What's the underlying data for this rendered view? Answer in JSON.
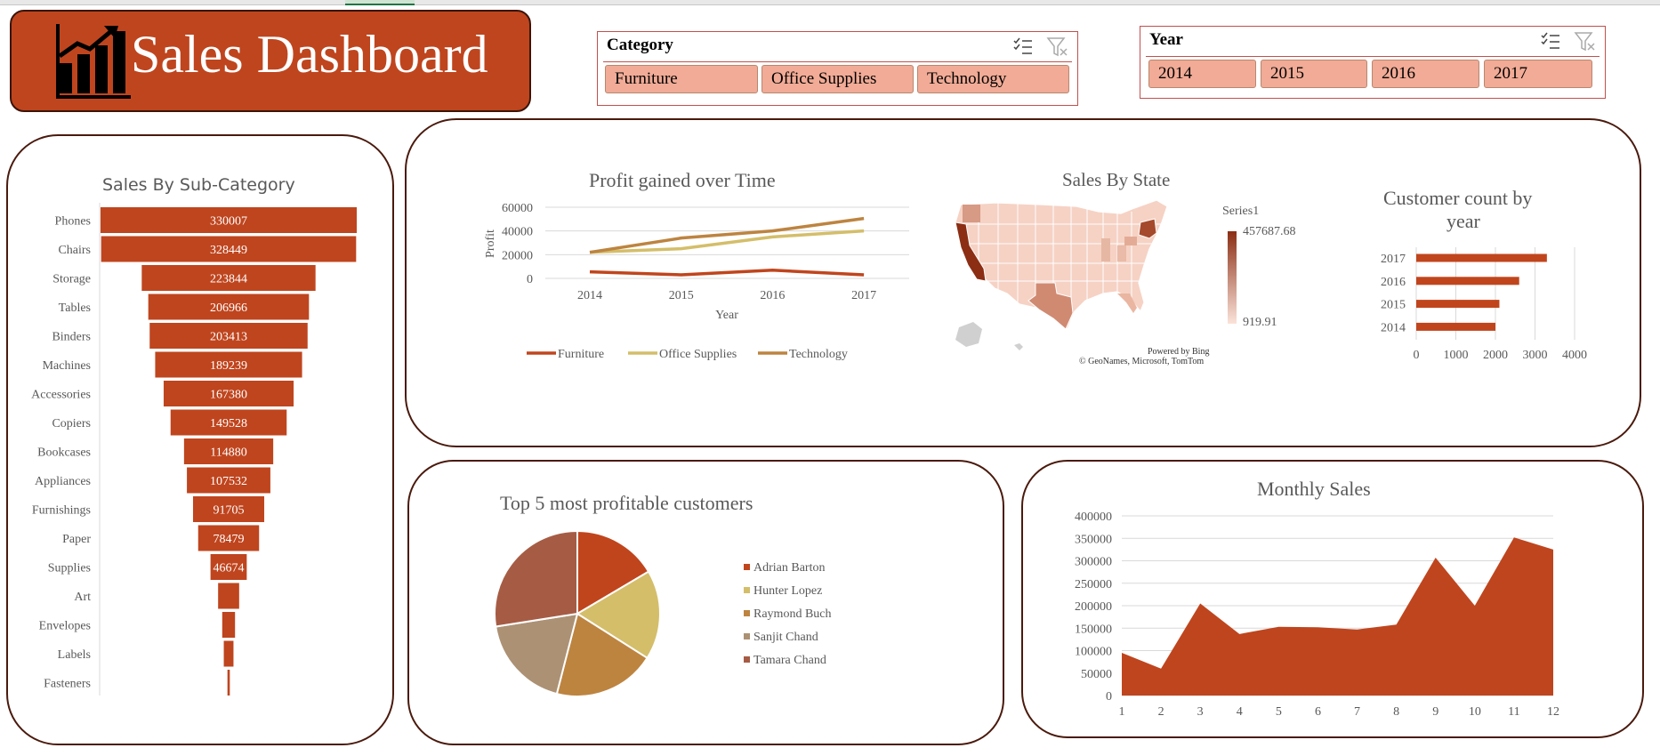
{
  "dashboard": {
    "title": "Sales Dashboard",
    "colors": {
      "accent": "#bf451e",
      "dark": "#4a1a0d",
      "slicer_item": "#f1ab96"
    }
  },
  "slicers": {
    "category": {
      "header": "Category",
      "items": [
        "Furniture",
        "Office Supplies",
        "Technology"
      ],
      "icons": [
        "multi-select-icon",
        "clear-filter-icon"
      ]
    },
    "year": {
      "header": "Year",
      "items": [
        "2014",
        "2015",
        "2016",
        "2017"
      ],
      "icons": [
        "multi-select-icon",
        "clear-filter-icon"
      ]
    }
  },
  "sales_by_subcategory": {
    "title": "Sales By Sub-Category",
    "chart_data": {
      "type": "bar",
      "orientation": "horizontal-funnel",
      "categories": [
        "Phones",
        "Chairs",
        "Storage",
        "Tables",
        "Binders",
        "Machines",
        "Accessories",
        "Copiers",
        "Bookcases",
        "Appliances",
        "Furnishings",
        "Paper",
        "Supplies",
        "Art",
        "Envelopes",
        "Labels",
        "Fasteners"
      ],
      "values": [
        330007,
        328449,
        223844,
        206966,
        203413,
        189239,
        167380,
        149528,
        114880,
        107532,
        91705,
        78479,
        46674,
        27119,
        16476,
        12486,
        3024
      ],
      "data_labels": [
        "330007",
        "328449",
        "223844",
        "206966",
        "203413",
        "189239",
        "167380",
        "149528",
        "114880",
        "107532",
        "91705",
        "78479",
        "46674",
        "",
        "",
        "",
        ""
      ],
      "color": "#bf451e"
    }
  },
  "profit_over_time": {
    "title": "Profit gained over Time",
    "chart_data": {
      "type": "line",
      "x": [
        "2014",
        "2015",
        "2016",
        "2017"
      ],
      "xlabel": "Year",
      "ylabel": "Profit",
      "yticks": [
        "60000",
        "40000",
        "20000",
        "0"
      ],
      "ylim": [
        0,
        60000
      ],
      "series": [
        {
          "name": "Furniture",
          "values": [
            5500,
            3000,
            6900,
            3000
          ],
          "color": "#c0451d"
        },
        {
          "name": "Office Supplies",
          "values": [
            22000,
            25000,
            35000,
            40000
          ],
          "color": "#d4be6a"
        },
        {
          "name": "Technology",
          "values": [
            22000,
            34000,
            40000,
            50500
          ],
          "color": "#bd8440"
        }
      ],
      "grid": true,
      "legend": "bottom"
    }
  },
  "sales_by_state": {
    "title": "Sales By State",
    "legend_series": "Series1",
    "legend_max": "457687.68",
    "legend_min": "919.91",
    "attribution_1": "Powered by Bing",
    "attribution_2": "© GeoNames, Microsoft, TomTom"
  },
  "customer_count": {
    "title_line1": "Customer count by",
    "title_line2": "year",
    "chart_data": {
      "type": "bar",
      "orientation": "horizontal",
      "categories": [
        "2017",
        "2016",
        "2015",
        "2014"
      ],
      "values": [
        3300,
        2600,
        2100,
        2000
      ],
      "xticks": [
        "0",
        "1000",
        "2000",
        "3000",
        "4000"
      ],
      "xlim": [
        0,
        4000
      ],
      "color": "#c0451d"
    }
  },
  "top5_customers": {
    "title": "Top 5 most profitable customers",
    "chart_data": {
      "type": "pie",
      "labels": [
        "Adrian Barton",
        "Hunter Lopez",
        "Raymond Buch",
        "Sanjit Chand",
        "Tamara Chand"
      ],
      "values": [
        16.5,
        17.5,
        20,
        18.5,
        27.5
      ],
      "colors": [
        "#c0451d",
        "#d4be6a",
        "#bd8440",
        "#ac9174",
        "#a65c44"
      ],
      "legend": "right"
    }
  },
  "monthly_sales": {
    "title": "Monthly Sales",
    "chart_data": {
      "type": "area",
      "x": [
        "1",
        "2",
        "3",
        "4",
        "5",
        "6",
        "7",
        "8",
        "9",
        "10",
        "11",
        "12"
      ],
      "values": [
        95000,
        60000,
        205000,
        137000,
        153000,
        152000,
        147000,
        158000,
        307000,
        200000,
        352000,
        325000
      ],
      "yticks": [
        "400000",
        "350000",
        "300000",
        "250000",
        "200000",
        "150000",
        "100000",
        "50000",
        "0"
      ],
      "ylim": [
        0,
        400000
      ],
      "color": "#bf451e",
      "grid": true
    }
  }
}
